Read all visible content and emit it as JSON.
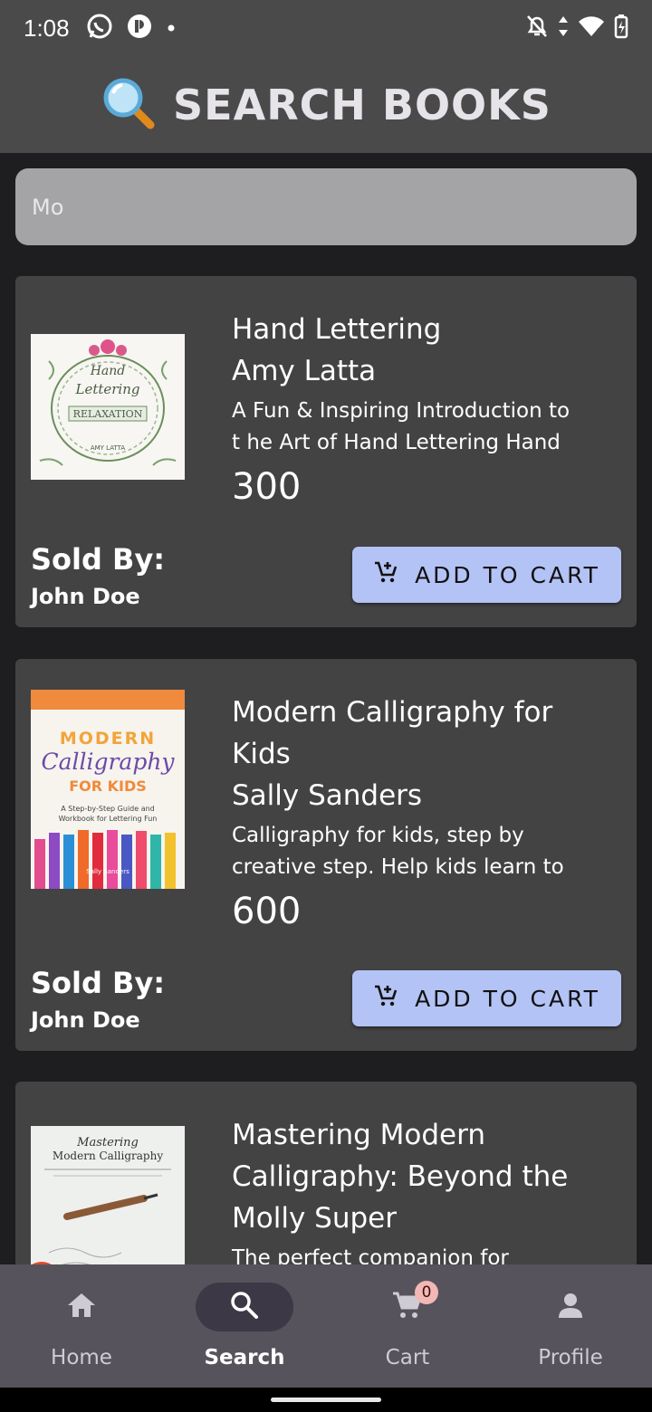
{
  "status_bar": {
    "time": "1:08",
    "left_icons": [
      "whatsapp-icon",
      "app-icon",
      "dot-icon"
    ],
    "right_icons": [
      "mute-icon",
      "data-icon",
      "wifi-icon",
      "battery-icon"
    ]
  },
  "header": {
    "icon": "magnifier-icon",
    "title": "SEARCH BOOKS"
  },
  "search": {
    "value": "Mo"
  },
  "books": [
    {
      "title": "Hand Lettering",
      "author": "Amy Latta",
      "description_line1": "A Fun & Inspiring Introduction to",
      "description_line2": "t he Art of Hand Lettering Hand",
      "price": "300",
      "sold_by_label": "Sold By:",
      "seller": "John Doe",
      "button_label": "ADD TO CART",
      "cover_text_1": "Hand",
      "cover_text_2": "Lettering",
      "cover_text_3": "RELAXATION",
      "cover_text_4": "AMY LATTA"
    },
    {
      "title_line1": "Modern Calligraphy for",
      "title_line2": "Kids",
      "author": "Sally Sanders",
      "description_line1": "Calligraphy for kids, step by",
      "description_line2": "creative step. Help kids learn to",
      "price": "600",
      "sold_by_label": "Sold By:",
      "seller": "John Doe",
      "button_label": "ADD TO CART",
      "cover_text_1": "MODERN",
      "cover_text_2": "Calligraphy",
      "cover_text_3": "FOR KIDS",
      "cover_text_4": "A Step-by-Step Guide and",
      "cover_text_5": "Workbook for Lettering Fun",
      "cover_text_6": "Sally Sanders"
    },
    {
      "title_line1": "Mastering Modern",
      "title_line2": "Calligraphy: Beyond the",
      "author": "Molly Super",
      "description_line1": "The perfect companion for",
      "cover_text_1": "Mastering",
      "cover_text_2": "Modern Calligraphy"
    }
  ],
  "nav": {
    "items": [
      {
        "label": "Home",
        "icon": "home-icon"
      },
      {
        "label": "Search",
        "icon": "search-icon"
      },
      {
        "label": "Cart",
        "icon": "cart-icon",
        "badge": "0"
      },
      {
        "label": "Profile",
        "icon": "profile-icon"
      }
    ]
  }
}
